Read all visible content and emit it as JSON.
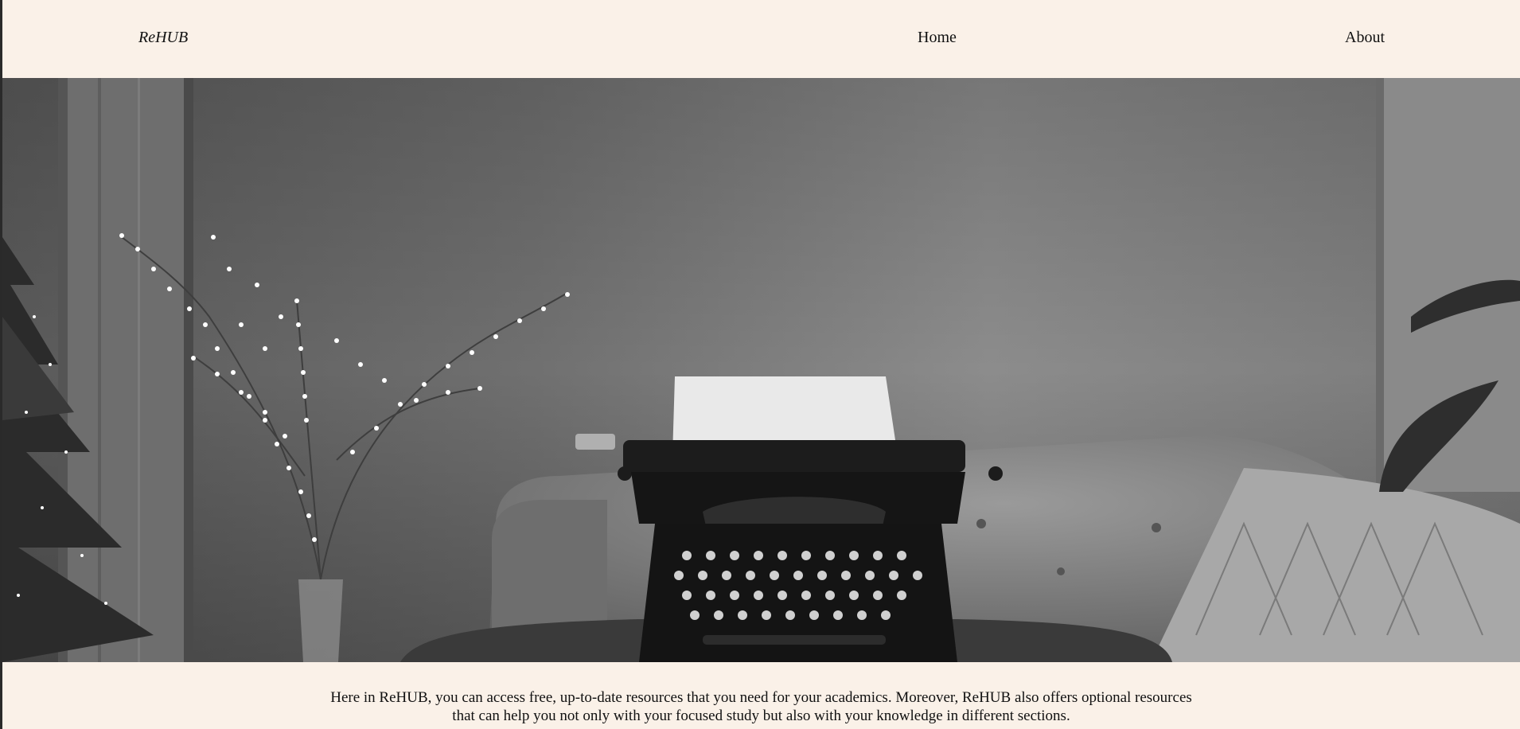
{
  "nav": {
    "brand": "ReHUB",
    "links": [
      {
        "label": "Home"
      },
      {
        "label": "About"
      }
    ]
  },
  "hero": {
    "image_description_icon": "typewriter-photo"
  },
  "intro": {
    "line1": "Here in ReHUB, you can access free, up-to-date resources that you need for your academics. Moreover, ReHUB also offers optional resources",
    "line2": "that can help you not only with your focused study but also with your knowledge in different sections."
  },
  "colors": {
    "background": "#faf1e8",
    "text": "#111111"
  }
}
